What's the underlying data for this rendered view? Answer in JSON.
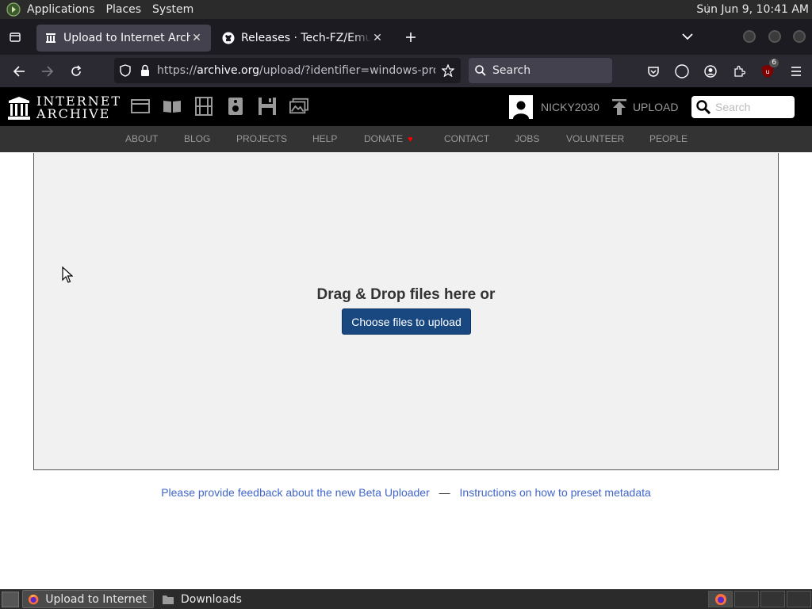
{
  "top_panel": {
    "menus": [
      "Applications",
      "Places",
      "System"
    ],
    "clock": "Sun Jun  9, 10:41 AM"
  },
  "browser": {
    "tabs": [
      {
        "title": "Upload to Internet Archive",
        "active": true
      },
      {
        "title": "Releases · Tech-FZ/EmuGUI",
        "active": false
      }
    ],
    "url_prefix": "https://",
    "url_host": "archive.org",
    "url_rest": "/upload/?identifier=windows-program",
    "search_placeholder": "Search",
    "extension_badge": "6"
  },
  "ia_header": {
    "logo_line1": "INTERNET",
    "logo_line2": "ARCHIVE",
    "media_icons": [
      "web-icon",
      "texts-icon",
      "video-icon",
      "audio-icon",
      "software-icon",
      "images-icon"
    ],
    "username": "NICKY2030",
    "upload_label": "UPLOAD",
    "search_placeholder": "Search"
  },
  "ia_nav": {
    "items": [
      "ABOUT",
      "BLOG",
      "PROJECTS",
      "HELP",
      "DONATE",
      "CONTACT",
      "JOBS",
      "VOLUNTEER",
      "PEOPLE"
    ]
  },
  "upload": {
    "drop_text": "Drag & Drop files here or",
    "choose_button": "Choose files to upload",
    "feedback_link": "Please provide feedback about the new Beta Uploader",
    "separator": "—",
    "instructions_link": "Instructions on how to preset metadata"
  },
  "taskbar": {
    "items": [
      {
        "label": "Upload to Internet ...",
        "active": true
      },
      {
        "label": "Downloads",
        "active": false
      }
    ]
  },
  "colors": {
    "button_blue": "#194880",
    "link_blue": "#4166c9",
    "donate_heart": "#ff0000"
  }
}
